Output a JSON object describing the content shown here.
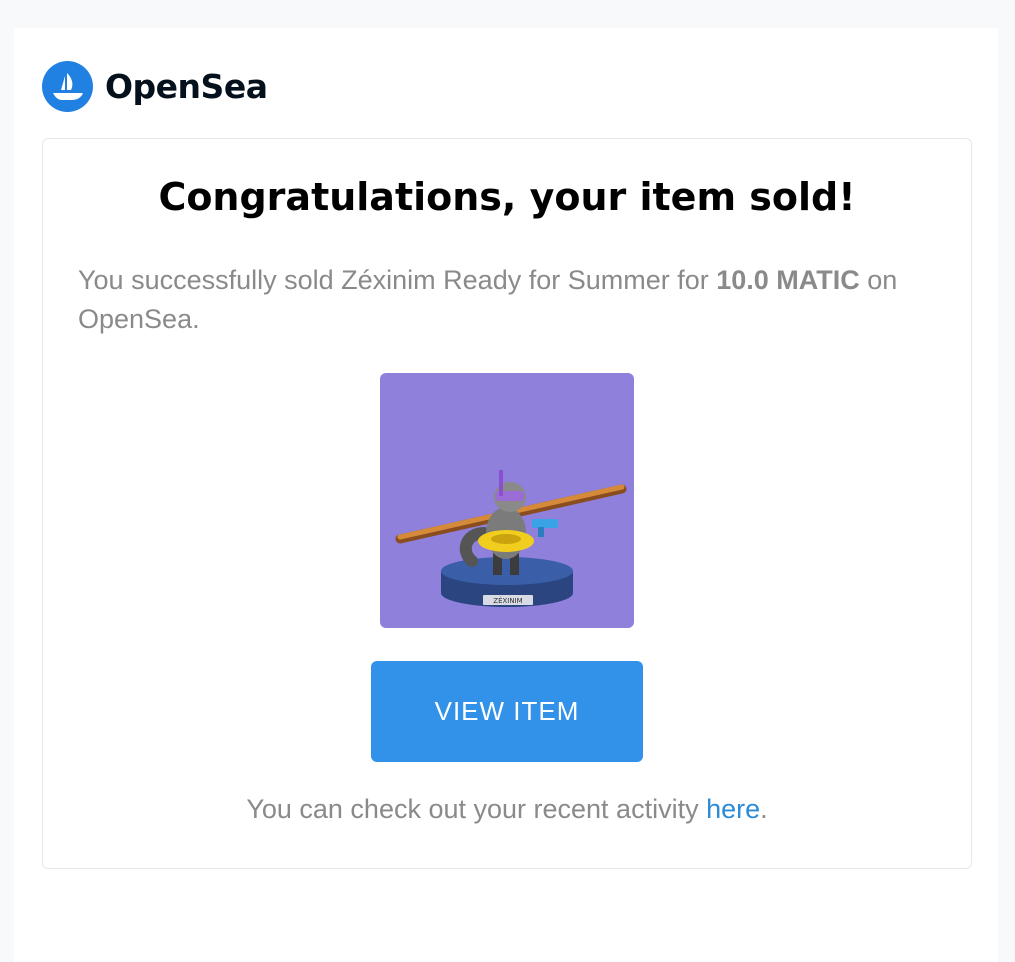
{
  "brand": {
    "name": "OpenSea",
    "color": "#2081e2",
    "icon": "opensea-boat-icon"
  },
  "email": {
    "headline": "Congratulations, your item sold!",
    "message_prefix": "You successfully sold Zéxinim Ready for Summer for ",
    "price": "10.0 MATIC",
    "message_suffix": " on OpenSea.",
    "nft": {
      "background_color": "#8f80dc",
      "pedestal_label": "ZÉXINIM"
    },
    "button_label": "VIEW ITEM",
    "button_color": "#3291e9",
    "footer_prefix": "You can check out your recent activity ",
    "footer_link": "here",
    "footer_suffix": "."
  }
}
